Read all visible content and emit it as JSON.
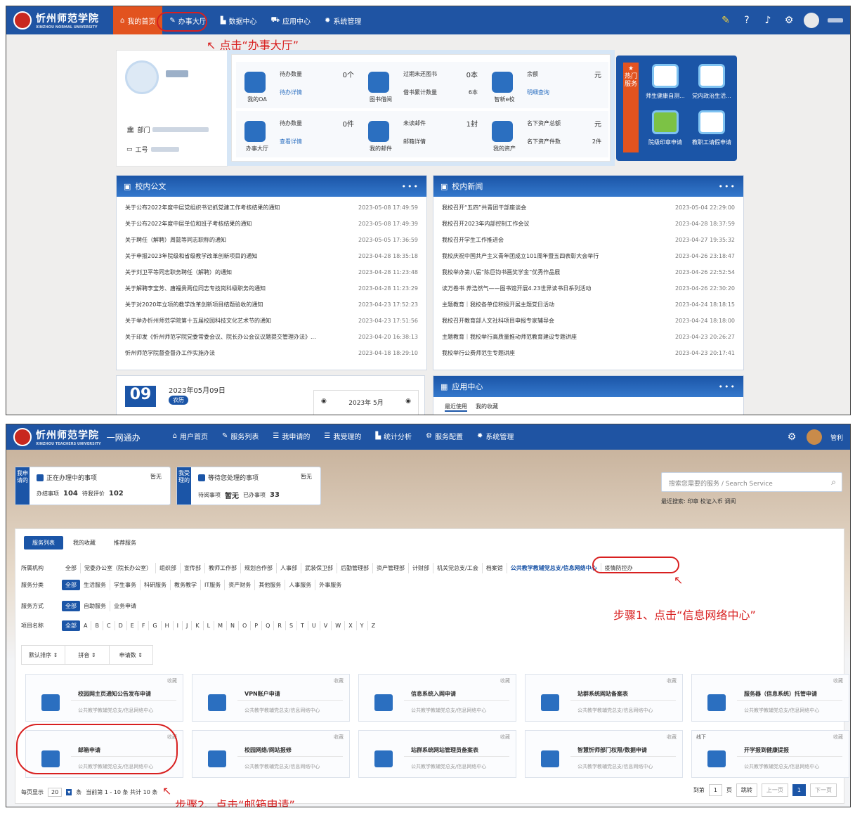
{
  "shot1": {
    "logo": {
      "cn": "忻州师范学院",
      "en": "XINZHOU NORMAL UNIVERSITY"
    },
    "menu": [
      {
        "label": "我的首页",
        "icon": "home-icon"
      },
      {
        "label": "办事大厅",
        "icon": "edit-icon"
      },
      {
        "label": "数据中心",
        "icon": "chart-icon"
      },
      {
        "label": "应用中心",
        "icon": "cart-icon"
      },
      {
        "label": "系统管理",
        "icon": "gear-icon"
      }
    ],
    "annotation": "点击“办事大厅”",
    "profile": {
      "dept_label": "部门",
      "id_label": "工号"
    },
    "stats": [
      {
        "name": "我的OA",
        "l1": "待办数量",
        "v1": "0个",
        "l2": "待办详情",
        "v2": ""
      },
      {
        "name": "图书借阅",
        "l1": "过期未还图书",
        "v1": "0本",
        "l2": "借书累计数量",
        "v2": "6本"
      },
      {
        "name": "智新e校",
        "l1": "余额",
        "v1": "元",
        "l2": "明细查询",
        "v2": ""
      },
      {
        "name": "办事大厅",
        "l1": "待办数量",
        "v1": "0件",
        "l2": "查看详情",
        "v2": ""
      },
      {
        "name": "我的邮件",
        "l1": "未读邮件",
        "v1": "1封",
        "l2": "邮箱详情",
        "v2": ""
      },
      {
        "name": "我的资产",
        "l1": "名下资产总额",
        "v1": "元",
        "l2": "名下资产件数",
        "v2": "2件"
      }
    ],
    "hot": {
      "tab": "热门服务",
      "items": [
        "师生健康自测...",
        "党内政治生活...",
        "院级印章申请",
        "教职工请假申请"
      ]
    },
    "notice": {
      "title": "校内公文",
      "rows": [
        {
          "t": "关于公布2022年度中层党组织书记抓党建工作考核结果的通知",
          "d": "2023-05-08 17:49:59"
        },
        {
          "t": "关于公布2022年度中层单位和班子考核结果的通知",
          "d": "2023-05-08 17:49:39"
        },
        {
          "t": "关于聘任（解聘）周懿等同志职称的通知",
          "d": "2023-05-05 17:36:59"
        },
        {
          "t": "关于申报2023年院级和省级教学改革创新项目的通知",
          "d": "2023-04-28 18:35:18"
        },
        {
          "t": "关于刘卫平等同志职务聘任（解聘）的通知",
          "d": "2023-04-28 11:23:48"
        },
        {
          "t": "关于解聘李宝芳、唐福贵两位同志专技岗科级职务的通知",
          "d": "2023-04-28 11:23:29"
        },
        {
          "t": "关于对2020年立项的教学改革创新项目结题验收的通知",
          "d": "2023-04-23 17:52:23"
        },
        {
          "t": "关于举办忻州师范学院第十五届校园科技文化艺术节的通知",
          "d": "2023-04-23 17:51:56"
        },
        {
          "t": "关于印发《忻州师范学院党委常委会议、院长办公会议议题提交管理办法》...",
          "d": "2023-04-20 16:38:13"
        },
        {
          "t": "忻州师范学院督查督办工作实施办法",
          "d": "2023-04-18 18:29:10"
        }
      ]
    },
    "news": {
      "title": "校内新闻",
      "rows": [
        {
          "t": "我校召开“五四”共青团干部座谈会",
          "d": "2023-05-04 22:29:00"
        },
        {
          "t": "我校召开2023年内部控制工作会议",
          "d": "2023-04-28 18:37:59"
        },
        {
          "t": "我校召开学生工作推进会",
          "d": "2023-04-27 19:35:32"
        },
        {
          "t": "我校庆祝中国共产主义青年团成立101周年暨五四表彰大会举行",
          "d": "2023-04-26 23:18:47"
        },
        {
          "t": "我校举办第八届“陈巨钧书画奖学金”优秀作品展",
          "d": "2023-04-26 22:52:54"
        },
        {
          "t": "读万卷书 养浩然气——图书馆开展4.23世界读书日系列活动",
          "d": "2023-04-26 22:30:20"
        },
        {
          "t": "主题教育｜我校各单位积极开展主题党日活动",
          "d": "2023-04-24 18:18:15"
        },
        {
          "t": "我校召开教育部人文社科项目申报专家辅导会",
          "d": "2023-04-24 18:18:00"
        },
        {
          "t": "主题教育｜我校举行高质量推动师范教育建设专题讲座",
          "d": "2023-04-23 20:26:27"
        },
        {
          "t": "我校举行公费师范生专题讲座",
          "d": "2023-04-23 20:17:41"
        }
      ]
    },
    "calendar": {
      "day": "09",
      "title": "2023年05月09日",
      "lunar": "农历",
      "month": "2023年 5月"
    },
    "apps": {
      "title": "应用中心",
      "tab1": "最近使用",
      "tab2": "我的收藏"
    }
  },
  "shot2": {
    "logo": {
      "cn": "忻州师范学院",
      "en": "XINZHOU TEACHERS UNIVERSITY",
      "sub": "一网通办"
    },
    "menu": [
      {
        "label": "用户首页",
        "icon": "home-icon"
      },
      {
        "label": "服务列表",
        "icon": "edit-icon"
      },
      {
        "label": "我申请的",
        "icon": "list-icon"
      },
      {
        "label": "我受理的",
        "icon": "list-icon"
      },
      {
        "label": "统计分析",
        "icon": "chart-icon"
      },
      {
        "label": "服务配置",
        "icon": "gears-icon"
      },
      {
        "label": "系统管理",
        "icon": "gear-icon"
      }
    ],
    "user": "管利",
    "apply_box": {
      "vtab": "我申请的",
      "title": "正在办理中的事项",
      "none": "暂无",
      "l1": "办结事项",
      "v1": "104",
      "l2": "待我评价",
      "v2": "102"
    },
    "accept_box": {
      "vtab": "我受理的",
      "title": "等待您处理的事项",
      "none": "暂无",
      "l1": "待阅事项",
      "v1": "暂无",
      "l2": "已办事项",
      "v2": "33"
    },
    "search": {
      "placeholder": "搜索您需要的服务 / Search Service",
      "recent_label": "最近搜索:",
      "recent": [
        "印章",
        "校证入币",
        "调阅"
      ]
    },
    "tabs": [
      "服务列表",
      "我的收藏",
      "推荐服务"
    ],
    "filters": {
      "org_label": "所属机构",
      "org": [
        "全部",
        "党委办公室（院长办公室）",
        "组织部",
        "宣传部",
        "教师工作部",
        "规划合作部",
        "人事部",
        "武装保卫部",
        "后勤管理部",
        "资产管理部",
        "计财部",
        "机关党总支/工会",
        "档案馆",
        "公共教学教辅党总支/信息网络中心",
        "疫情防控办"
      ],
      "cat_label": "服务分类",
      "cat": [
        "全部",
        "生活服务",
        "学生事务",
        "科研服务",
        "教务教学",
        "IT服务",
        "资产财务",
        "其他服务",
        "人事服务",
        "外事服务"
      ],
      "mode_label": "服务方式",
      "mode": [
        "全部",
        "自助服务",
        "业务申请"
      ],
      "name_label": "项目名称",
      "letters": [
        "全部",
        "A",
        "B",
        "C",
        "D",
        "E",
        "F",
        "G",
        "H",
        "I",
        "J",
        "K",
        "L",
        "M",
        "N",
        "O",
        "P",
        "Q",
        "R",
        "S",
        "T",
        "U",
        "V",
        "W",
        "X",
        "Y",
        "Z"
      ]
    },
    "sorts": [
      "默认排序",
      "拼音",
      "申请数"
    ],
    "fav_label": "收藏",
    "online_label": "线下",
    "dept": "公共教学教辅党总支/信息网络中心",
    "services": [
      "校园网主页通知公告发布申请",
      "VPN账户申请",
      "信息系统入网申请",
      "站群系统网站备案表",
      "服务器（信息系统）托管申请",
      "邮箱申请",
      "校园网络/网站报修",
      "站群系统网站管理员备案表",
      "智慧忻师部门权限/数据申请",
      "开学报到健康提报"
    ],
    "step1": "步骤1、点击“信息网络中心”",
    "step2": "步骤2、点击“邮箱申请”",
    "pager": {
      "per": "每页显示",
      "size": "20",
      "unit": "条",
      "info": "当前第 1 - 10 条 共计 10 条",
      "goto": "到第",
      "page": "1",
      "pageu": "页",
      "jump": "跳转",
      "prev": "上一页",
      "cur": "1",
      "next": "下一页"
    }
  }
}
